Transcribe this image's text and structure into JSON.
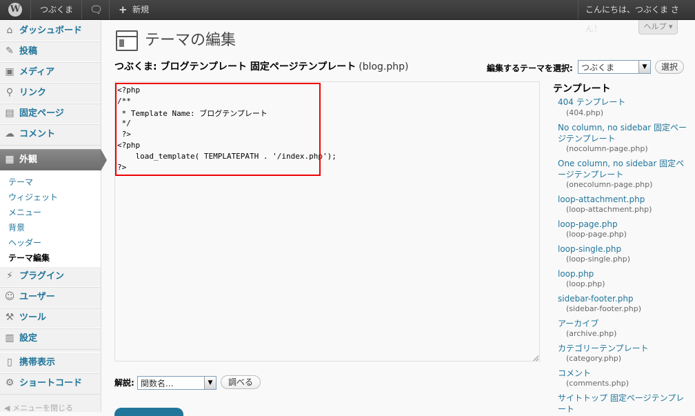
{
  "adminbar": {
    "site_name": "つぶくま",
    "comments_count": "",
    "new_label": "新規",
    "greeting": "こんにちは、つぶくま さん！"
  },
  "sidebar": {
    "items": [
      {
        "label": "ダッシュボード",
        "icon": "dashboard-icon"
      },
      {
        "label": "投稿",
        "icon": "pin-icon"
      },
      {
        "label": "メディア",
        "icon": "media-icon"
      },
      {
        "label": "リンク",
        "icon": "link-icon"
      },
      {
        "label": "固定ページ",
        "icon": "page-icon"
      },
      {
        "label": "コメント",
        "icon": "comment-icon"
      },
      {
        "label": "外観",
        "icon": "appearance-icon"
      },
      {
        "label": "プラグイン",
        "icon": "plugin-icon"
      },
      {
        "label": "ユーザー",
        "icon": "users-icon"
      },
      {
        "label": "ツール",
        "icon": "tools-icon"
      },
      {
        "label": "設定",
        "icon": "settings-icon"
      },
      {
        "label": "携帯表示",
        "icon": "mobile-icon"
      },
      {
        "label": "ショートコード",
        "icon": "gear-icon"
      }
    ],
    "submenu": [
      "テーマ",
      "ウィジェット",
      "メニュー",
      "背景",
      "ヘッダー",
      "テーマ編集"
    ],
    "collapse_label": "メニューを閉じる"
  },
  "help_label": "ヘルプ ▾",
  "page": {
    "title": "テーマの編集",
    "subtitle": "つぶくま: ブログテンプレート 固定ページテンプレート",
    "file": "(blog.php)",
    "theme_select_label": "編集するテーマを選択:",
    "theme_selected": "つぶくま",
    "select_button": "選択"
  },
  "code_lines": [
    "<?php",
    "/**",
    " * Template Name: ブログテンプレート",
    " */",
    " ?>",
    "<?php",
    "    load_template( TEMPLATEPATH . '/index.php');",
    "?>"
  ],
  "documentation": {
    "label": "解説:",
    "select_value": "関数名...",
    "lookup_button": "調べる"
  },
  "templates": {
    "heading": "テンプレート",
    "items": [
      {
        "name": "404 テンプレート",
        "file": "(404.php)"
      },
      {
        "name": "No column, no sidebar 固定ページテンプレート",
        "file": "(nocolumn-page.php)"
      },
      {
        "name": "One column, no sidebar 固定ページテンプレート",
        "file": "(onecolumn-page.php)"
      },
      {
        "name": "loop-attachment.php",
        "file": "(loop-attachment.php)"
      },
      {
        "name": "loop-page.php",
        "file": "(loop-page.php)"
      },
      {
        "name": "loop-single.php",
        "file": "(loop-single.php)"
      },
      {
        "name": "loop.php",
        "file": "(loop.php)"
      },
      {
        "name": "sidebar-footer.php",
        "file": "(sidebar-footer.php)"
      },
      {
        "name": "アーカイブ",
        "file": "(archive.php)"
      },
      {
        "name": "カテゴリーテンプレート",
        "file": "(category.php)"
      },
      {
        "name": "コメント",
        "file": "(comments.php)"
      },
      {
        "name": "サイトトップ 固定ページテンプレート",
        "file": ""
      }
    ]
  }
}
